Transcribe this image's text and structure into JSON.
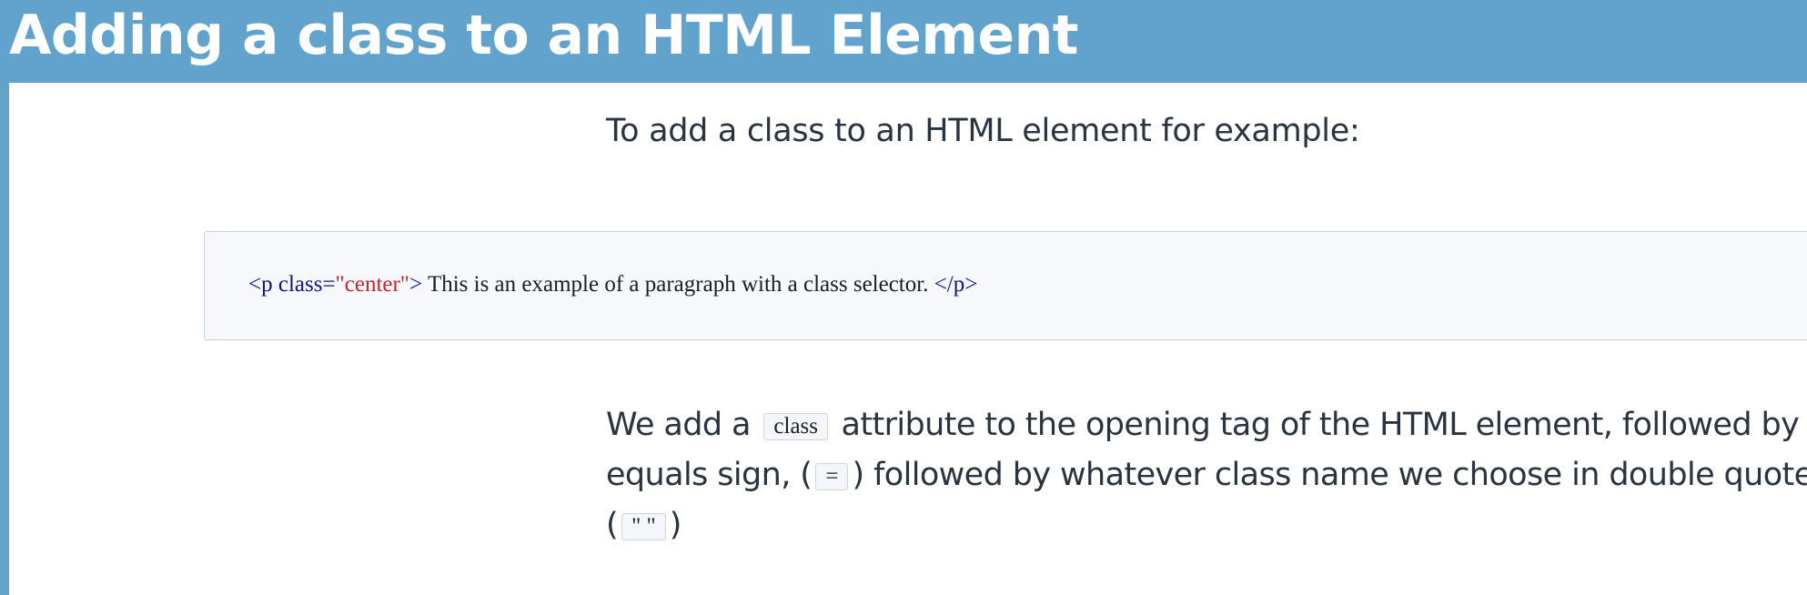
{
  "header": {
    "title": "Adding a class to an HTML Element"
  },
  "intro": {
    "text": "To add a class to an HTML element for example:"
  },
  "code_example": {
    "open_tag_start": "<p class=",
    "attr_value": "\"center\"",
    "open_tag_end": ">",
    "content": " This is an example of a paragraph with a class selector. ",
    "close_tag": "</p>"
  },
  "explanation": {
    "part1": "We add a",
    "code_class": "class",
    "part2": "attribute to the opening tag of the HTML element, followed by an",
    "part3": "equals sign, (",
    "code_equals": "=",
    "part4": ") followed by whatever class name we choose in double quotes.",
    "part5": "(",
    "code_quotes": "\" \"",
    "part6": ")"
  },
  "colors": {
    "header_background": "#62a3cd",
    "title_text": "#ffffff",
    "body_text": "#2a3440",
    "code_tag": "#13128a",
    "code_value": "#c0272d",
    "code_box_background": "#f7f8fb",
    "code_box_border": "#c2d3e3"
  }
}
